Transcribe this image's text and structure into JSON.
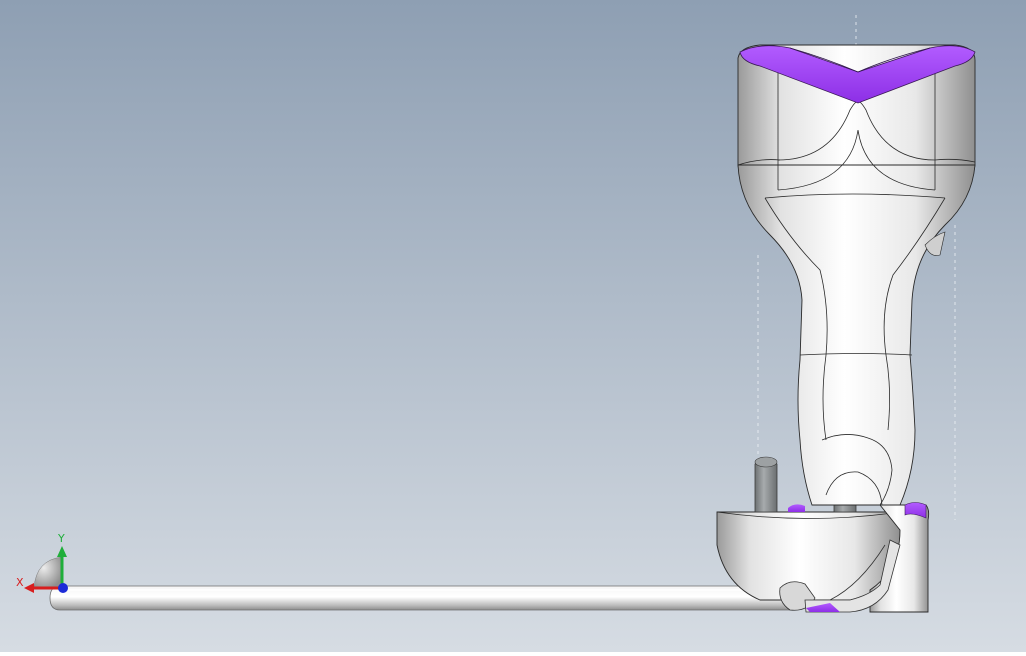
{
  "viewport": {
    "background_top": "#8e9fb3",
    "background_bottom": "#d6dce3",
    "accent_color": "#9a3df0",
    "body_color": "#dcdcdc",
    "pin_color": "#8a8e90"
  },
  "triad": {
    "x_label": "X",
    "y_label": "Y",
    "x_color": "#d81e1e",
    "y_color": "#1fae3a",
    "z_color": "#1c2bd8"
  }
}
